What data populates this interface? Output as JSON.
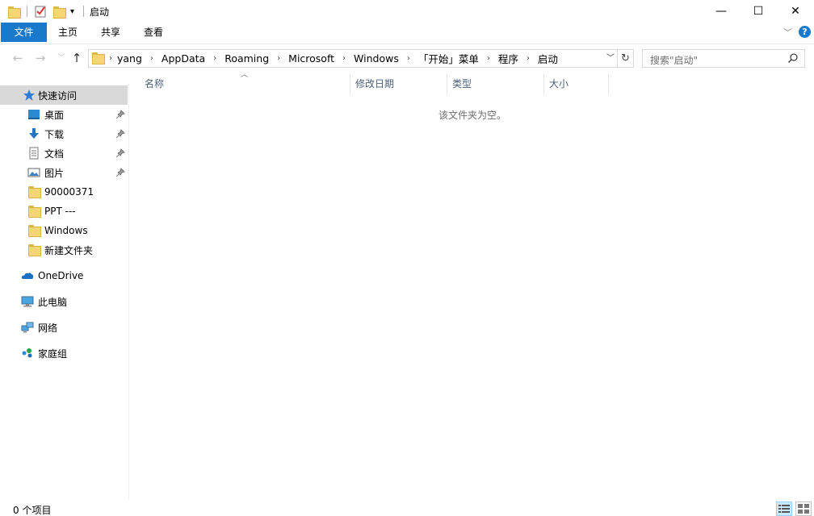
{
  "window": {
    "title": "启动",
    "minimize": "—",
    "maximize": "☐",
    "close": "✕"
  },
  "ribbon": {
    "tabs": [
      "文件",
      "主页",
      "共享",
      "查看"
    ],
    "help": "?"
  },
  "address": {
    "crumbs": [
      "yang",
      "AppData",
      "Roaming",
      "Microsoft",
      "Windows",
      "「开始」菜单",
      "程序",
      "启动"
    ]
  },
  "search": {
    "placeholder": "搜索\"启动\""
  },
  "nav": {
    "quick_access": "快速访问",
    "pinned": [
      "桌面",
      "下载",
      "文档",
      "图片"
    ],
    "folders": [
      "90000371",
      "PPT ---",
      "Windows",
      "新建文件夹"
    ],
    "onedrive": "OneDrive",
    "this_pc": "此电脑",
    "network": "网络",
    "homegroup": "家庭组"
  },
  "columns": [
    "名称",
    "修改日期",
    "类型",
    "大小"
  ],
  "content": {
    "empty_message": "该文件夹为空。"
  },
  "status": {
    "count": "0 个项目"
  },
  "colors": {
    "accent": "#1979ca",
    "selected_nav": "#d9d9d9",
    "header_text": "#4c607a"
  }
}
